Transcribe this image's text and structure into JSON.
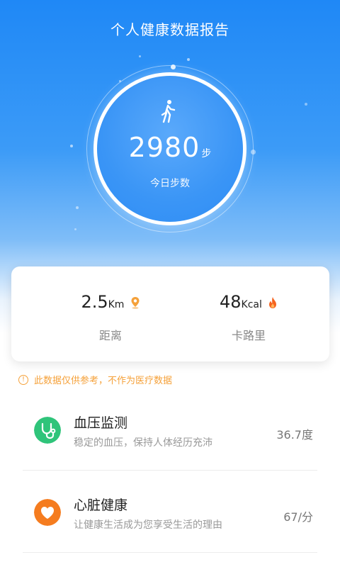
{
  "header": {
    "title": "个人健康数据报告"
  },
  "steps": {
    "value": "2980",
    "unit": "步",
    "label": "今日步数"
  },
  "stats": {
    "distance": {
      "value": "2.5",
      "unit": "Km",
      "label": "距离",
      "icon": "location-pin-icon"
    },
    "calories": {
      "value": "48",
      "unit": "Kcal",
      "label": "卡路里",
      "icon": "flame-icon"
    }
  },
  "notice": {
    "icon": "warning-icon",
    "text": "此数据仅供参考，不作为医疗数据"
  },
  "items": [
    {
      "title": "血压监测",
      "desc": "稳定的血压，保持人体经历充沛",
      "value": "36.7度",
      "icon": "stethoscope-icon",
      "color": "#2fc47a"
    },
    {
      "title": "心脏健康",
      "desc": "让健康生活成为您享受生活的理由",
      "value": "67/分",
      "icon": "heart-icon",
      "color": "#f57c1f"
    }
  ],
  "colors": {
    "primary": "#1f88f6",
    "warning": "#f5a13a"
  }
}
